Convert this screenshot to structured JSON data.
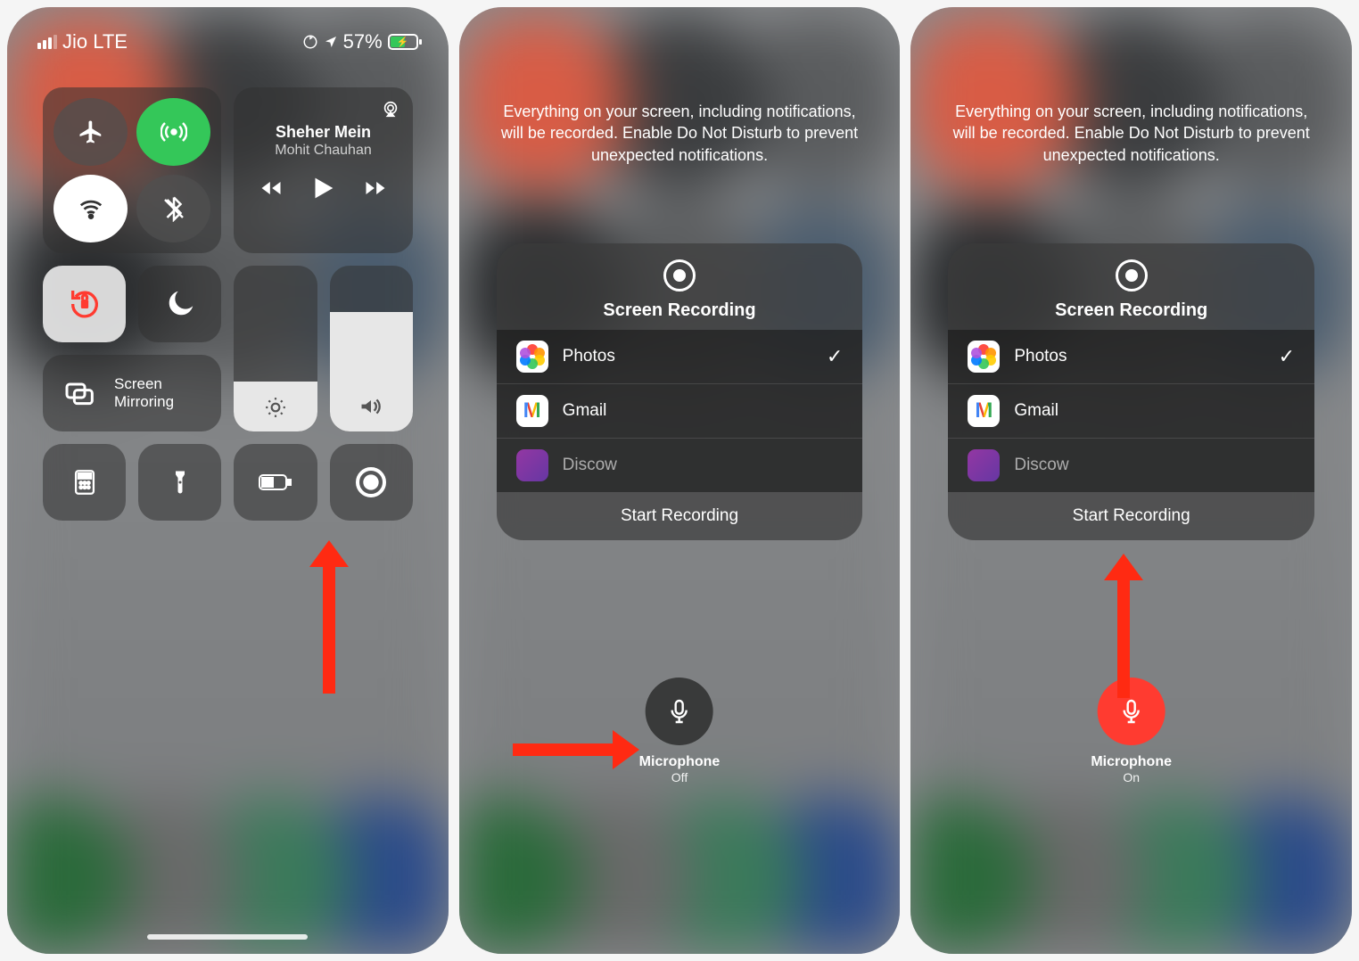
{
  "status": {
    "carrier": "Jio LTE",
    "battery_pct": "57%"
  },
  "media": {
    "title": "Sheher Mein",
    "artist": "Mohit Chauhan"
  },
  "mirror_label": "Screen Mirroring",
  "hint_text": "Everything on your screen, including notifications, will be recorded. Enable Do Not Disturb to prevent unexpected notifications.",
  "rec": {
    "title": "Screen Recording",
    "items": [
      "Photos",
      "Gmail",
      "Discow"
    ],
    "start": "Start Recording"
  },
  "mic": {
    "label": "Microphone",
    "off": "Off",
    "on": "On"
  }
}
